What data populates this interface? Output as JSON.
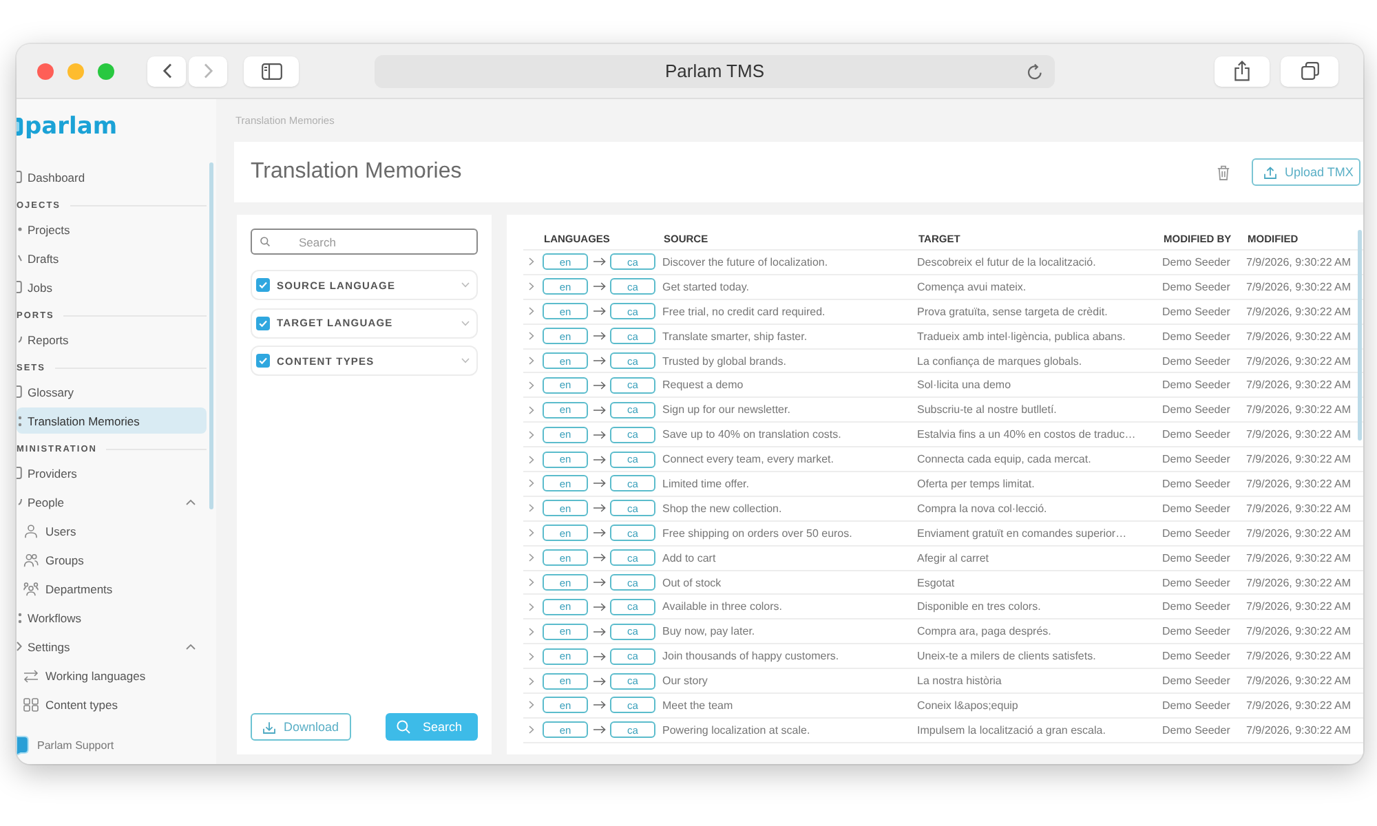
{
  "browser": {
    "title": "Parlam TMS"
  },
  "sidebar": {
    "logo": "parlam",
    "sections": [
      {
        "items": [
          {
            "label": "Dashboard",
            "selected": false
          }
        ]
      },
      {
        "title": "OJECTS",
        "items": [
          {
            "label": "Projects",
            "selected": false
          },
          {
            "label": "Drafts",
            "selected": false
          },
          {
            "label": "Jobs",
            "selected": false
          }
        ]
      },
      {
        "title": "PORTS",
        "items": [
          {
            "label": "Reports",
            "selected": false
          }
        ]
      },
      {
        "title": "SETS",
        "items": [
          {
            "label": "Glossary",
            "selected": false
          },
          {
            "label": "Translation Memories",
            "selected": true
          }
        ]
      },
      {
        "title": "MINISTRATION",
        "items": [
          {
            "label": "Providers",
            "selected": false
          },
          {
            "label": "People",
            "selected": false,
            "expanded": true,
            "children": [
              {
                "label": "Users",
                "selected": false
              },
              {
                "label": "Groups",
                "selected": false
              },
              {
                "label": "Departments",
                "selected": false
              }
            ]
          },
          {
            "label": "Workflows",
            "selected": false
          },
          {
            "label": "Settings",
            "selected": false,
            "expanded": true,
            "children": [
              {
                "label": "Working languages",
                "selected": false
              },
              {
                "label": "Content types",
                "selected": false
              }
            ]
          }
        ]
      }
    ],
    "support": "Parlam Support"
  },
  "breadcrumb": "Translation Memories",
  "header": {
    "title": "Translation Memories",
    "upload_button": "Upload TMX"
  },
  "filters": {
    "search": {
      "placeholder": "Search"
    },
    "groups": [
      {
        "label": "SOURCE LANGUAGE",
        "checked": true
      },
      {
        "label": "TARGET LANGUAGE",
        "checked": true
      },
      {
        "label": "CONTENT TYPES",
        "checked": true
      }
    ],
    "download_button": "Download",
    "search_button": "Search"
  },
  "table": {
    "columns": [
      "LANGUAGES",
      "SOURCE",
      "TARGET",
      "MODIFIED BY",
      "MODIFIED"
    ],
    "rows": [
      {
        "source_language": "en",
        "target_language": "ca",
        "source": "Discover the future of localization.",
        "target": "Descobreix el futur de la localització.",
        "modified_by": "Demo Seeder",
        "modified": "7/9/2026, 9:30:22 AM"
      },
      {
        "source_language": "en",
        "target_language": "ca",
        "source": "Get started today.",
        "target": "Comença avui mateix.",
        "modified_by": "Demo Seeder",
        "modified": "7/9/2026, 9:30:22 AM"
      },
      {
        "source_language": "en",
        "target_language": "ca",
        "source": "Free trial, no credit card required.",
        "target": "Prova gratuïta, sense targeta de crèdit.",
        "modified_by": "Demo Seeder",
        "modified": "7/9/2026, 9:30:22 AM"
      },
      {
        "source_language": "en",
        "target_language": "ca",
        "source": "Translate smarter, ship faster.",
        "target": "Tradueix amb intel·ligència, publica abans.",
        "modified_by": "Demo Seeder",
        "modified": "7/9/2026, 9:30:22 AM"
      },
      {
        "source_language": "en",
        "target_language": "ca",
        "source": "Trusted by global brands.",
        "target": "La confiança de marques globals.",
        "modified_by": "Demo Seeder",
        "modified": "7/9/2026, 9:30:22 AM"
      },
      {
        "source_language": "en",
        "target_language": "ca",
        "source": "Request a demo",
        "target": "Sol·licita una demo",
        "modified_by": "Demo Seeder",
        "modified": "7/9/2026, 9:30:22 AM"
      },
      {
        "source_language": "en",
        "target_language": "ca",
        "source": "Sign up for our newsletter.",
        "target": "Subscriu-te al nostre butlletí.",
        "modified_by": "Demo Seeder",
        "modified": "7/9/2026, 9:30:22 AM"
      },
      {
        "source_language": "en",
        "target_language": "ca",
        "source": "Save up to 40% on translation costs.",
        "target": "Estalvia fins a un 40% en costos de traduc…",
        "modified_by": "Demo Seeder",
        "modified": "7/9/2026, 9:30:22 AM"
      },
      {
        "source_language": "en",
        "target_language": "ca",
        "source": "Connect every team, every market.",
        "target": "Connecta cada equip, cada mercat.",
        "modified_by": "Demo Seeder",
        "modified": "7/9/2026, 9:30:22 AM"
      },
      {
        "source_language": "en",
        "target_language": "ca",
        "source": "Limited time offer.",
        "target": "Oferta per temps limitat.",
        "modified_by": "Demo Seeder",
        "modified": "7/9/2026, 9:30:22 AM"
      },
      {
        "source_language": "en",
        "target_language": "ca",
        "source": "Shop the new collection.",
        "target": "Compra la nova col·lecció.",
        "modified_by": "Demo Seeder",
        "modified": "7/9/2026, 9:30:22 AM"
      },
      {
        "source_language": "en",
        "target_language": "ca",
        "source": "Free shipping on orders over 50 euros.",
        "target": "Enviament gratuït en comandes superior…",
        "modified_by": "Demo Seeder",
        "modified": "7/9/2026, 9:30:22 AM"
      },
      {
        "source_language": "en",
        "target_language": "ca",
        "source": "Add to cart",
        "target": "Afegir al carret",
        "modified_by": "Demo Seeder",
        "modified": "7/9/2026, 9:30:22 AM"
      },
      {
        "source_language": "en",
        "target_language": "ca",
        "source": "Out of stock",
        "target": "Esgotat",
        "modified_by": "Demo Seeder",
        "modified": "7/9/2026, 9:30:22 AM"
      },
      {
        "source_language": "en",
        "target_language": "ca",
        "source": "Available in three colors.",
        "target": "Disponible en tres colors.",
        "modified_by": "Demo Seeder",
        "modified": "7/9/2026, 9:30:22 AM"
      },
      {
        "source_language": "en",
        "target_language": "ca",
        "source": "Buy now, pay later.",
        "target": "Compra ara, paga després.",
        "modified_by": "Demo Seeder",
        "modified": "7/9/2026, 9:30:22 AM"
      },
      {
        "source_language": "en",
        "target_language": "ca",
        "source": "Join thousands of happy customers.",
        "target": "Uneix-te a milers de clients satisfets.",
        "modified_by": "Demo Seeder",
        "modified": "7/9/2026, 9:30:22 AM"
      },
      {
        "source_language": "en",
        "target_language": "ca",
        "source": "Our story",
        "target": "La nostra història",
        "modified_by": "Demo Seeder",
        "modified": "7/9/2026, 9:30:22 AM"
      },
      {
        "source_language": "en",
        "target_language": "ca",
        "source": "Meet the team",
        "target": "Coneix l&apos;equip",
        "modified_by": "Demo Seeder",
        "modified": "7/9/2026, 9:30:22 AM"
      },
      {
        "source_language": "en",
        "target_language": "ca",
        "source": "Powering localization at scale.",
        "target": "Impulsem la localització a gran escala.",
        "modified_by": "Demo Seeder",
        "modified": "7/9/2026, 9:30:22 AM"
      }
    ]
  }
}
